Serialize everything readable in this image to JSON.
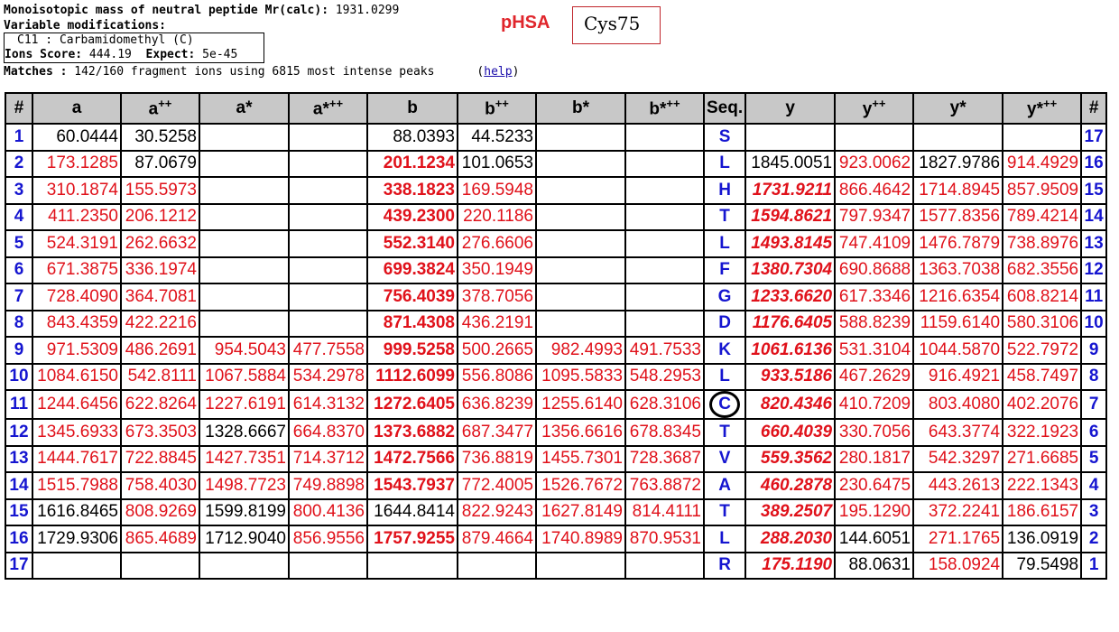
{
  "header": {
    "mass_label": "Monoisotopic mass of neutral peptide Mr(calc):",
    "mass_value": "1931.0299",
    "varmod_label": "Variable modifications:",
    "varmod_line": "C11 : Carbamidomethyl (C)",
    "score_label": "Ions Score:",
    "score_value": "444.19",
    "expect_label": "Expect:",
    "expect_value": "5e-45",
    "matches_label": "Matches :",
    "matches_value": "142/160 fragment ions using 6815 most intense peaks",
    "help_link": "help"
  },
  "protein_label": "pHSA",
  "site_label": "Cys75",
  "table": {
    "headers": [
      "#",
      "a",
      "a",
      "a*",
      "a*",
      "b",
      "b",
      "b*",
      "b*",
      "Seq.",
      "y",
      "y",
      "y*",
      "y*",
      "#"
    ],
    "header_sups": [
      "",
      "",
      "++",
      "",
      "++",
      "",
      "++",
      "",
      "++",
      "",
      "",
      "++",
      "",
      "++",
      ""
    ],
    "rows": [
      {
        "n": "1",
        "a": "60.0444",
        "a2": "30.5258",
        "as": "",
        "as2": "",
        "b": "88.0393",
        "b2": "44.5233",
        "bs": "",
        "bs2": "",
        "seq": "S",
        "y": "",
        "y2": "",
        "ys": "",
        "ys2": "",
        "m": "17"
      },
      {
        "n": "2",
        "a": "173.1285",
        "a2": "87.0679",
        "as": "",
        "as2": "",
        "b": "201.1234",
        "b2": "101.0653",
        "bs": "",
        "bs2": "",
        "seq": "L",
        "y": "1845.0051",
        "y2": "923.0062",
        "ys": "1827.9786",
        "ys2": "914.4929",
        "m": "16"
      },
      {
        "n": "3",
        "a": "310.1874",
        "a2": "155.5973",
        "as": "",
        "as2": "",
        "b": "338.1823",
        "b2": "169.5948",
        "bs": "",
        "bs2": "",
        "seq": "H",
        "y": "1731.9211",
        "y2": "866.4642",
        "ys": "1714.8945",
        "ys2": "857.9509",
        "m": "15"
      },
      {
        "n": "4",
        "a": "411.2350",
        "a2": "206.1212",
        "as": "",
        "as2": "",
        "b": "439.2300",
        "b2": "220.1186",
        "bs": "",
        "bs2": "",
        "seq": "T",
        "y": "1594.8621",
        "y2": "797.9347",
        "ys": "1577.8356",
        "ys2": "789.4214",
        "m": "14"
      },
      {
        "n": "5",
        "a": "524.3191",
        "a2": "262.6632",
        "as": "",
        "as2": "",
        "b": "552.3140",
        "b2": "276.6606",
        "bs": "",
        "bs2": "",
        "seq": "L",
        "y": "1493.8145",
        "y2": "747.4109",
        "ys": "1476.7879",
        "ys2": "738.8976",
        "m": "13"
      },
      {
        "n": "6",
        "a": "671.3875",
        "a2": "336.1974",
        "as": "",
        "as2": "",
        "b": "699.3824",
        "b2": "350.1949",
        "bs": "",
        "bs2": "",
        "seq": "F",
        "y": "1380.7304",
        "y2": "690.8688",
        "ys": "1363.7038",
        "ys2": "682.3556",
        "m": "12"
      },
      {
        "n": "7",
        "a": "728.4090",
        "a2": "364.7081",
        "as": "",
        "as2": "",
        "b": "756.4039",
        "b2": "378.7056",
        "bs": "",
        "bs2": "",
        "seq": "G",
        "y": "1233.6620",
        "y2": "617.3346",
        "ys": "1216.6354",
        "ys2": "608.8214",
        "m": "11"
      },
      {
        "n": "8",
        "a": "843.4359",
        "a2": "422.2216",
        "as": "",
        "as2": "",
        "b": "871.4308",
        "b2": "436.2191",
        "bs": "",
        "bs2": "",
        "seq": "D",
        "y": "1176.6405",
        "y2": "588.8239",
        "ys": "1159.6140",
        "ys2": "580.3106",
        "m": "10"
      },
      {
        "n": "9",
        "a": "971.5309",
        "a2": "486.2691",
        "as": "954.5043",
        "as2": "477.7558",
        "b": "999.5258",
        "b2": "500.2665",
        "bs": "982.4993",
        "bs2": "491.7533",
        "seq": "K",
        "y": "1061.6136",
        "y2": "531.3104",
        "ys": "1044.5870",
        "ys2": "522.7972",
        "m": "9"
      },
      {
        "n": "10",
        "a": "1084.6150",
        "a2": "542.8111",
        "as": "1067.5884",
        "as2": "534.2978",
        "b": "1112.6099",
        "b2": "556.8086",
        "bs": "1095.5833",
        "bs2": "548.2953",
        "seq": "L",
        "y": "933.5186",
        "y2": "467.2629",
        "ys": "916.4921",
        "ys2": "458.7497",
        "m": "8"
      },
      {
        "n": "11",
        "a": "1244.6456",
        "a2": "622.8264",
        "as": "1227.6191",
        "as2": "614.3132",
        "b": "1272.6405",
        "b2": "636.8239",
        "bs": "1255.6140",
        "bs2": "628.3106",
        "seq": "C",
        "y": "820.4346",
        "y2": "410.7209",
        "ys": "803.4080",
        "ys2": "402.2076",
        "m": "7"
      },
      {
        "n": "12",
        "a": "1345.6933",
        "a2": "673.3503",
        "as": "1328.6667",
        "as2": "664.8370",
        "b": "1373.6882",
        "b2": "687.3477",
        "bs": "1356.6616",
        "bs2": "678.8345",
        "seq": "T",
        "y": "660.4039",
        "y2": "330.7056",
        "ys": "643.3774",
        "ys2": "322.1923",
        "m": "6"
      },
      {
        "n": "13",
        "a": "1444.7617",
        "a2": "722.8845",
        "as": "1427.7351",
        "as2": "714.3712",
        "b": "1472.7566",
        "b2": "736.8819",
        "bs": "1455.7301",
        "bs2": "728.3687",
        "seq": "V",
        "y": "559.3562",
        "y2": "280.1817",
        "ys": "542.3297",
        "ys2": "271.6685",
        "m": "5"
      },
      {
        "n": "14",
        "a": "1515.7988",
        "a2": "758.4030",
        "as": "1498.7723",
        "as2": "749.8898",
        "b": "1543.7937",
        "b2": "772.4005",
        "bs": "1526.7672",
        "bs2": "763.8872",
        "seq": "A",
        "y": "460.2878",
        "y2": "230.6475",
        "ys": "443.2613",
        "ys2": "222.1343",
        "m": "4"
      },
      {
        "n": "15",
        "a": "1616.8465",
        "a2": "808.9269",
        "as": "1599.8199",
        "as2": "800.4136",
        "b": "1644.8414",
        "b2": "822.9243",
        "bs": "1627.8149",
        "bs2": "814.4111",
        "seq": "T",
        "y": "389.2507",
        "y2": "195.1290",
        "ys": "372.2241",
        "ys2": "186.6157",
        "m": "3"
      },
      {
        "n": "16",
        "a": "1729.9306",
        "a2": "865.4689",
        "as": "1712.9040",
        "as2": "856.9556",
        "b": "1757.9255",
        "b2": "879.4664",
        "bs": "1740.8989",
        "bs2": "870.9531",
        "seq": "L",
        "y": "288.2030",
        "y2": "144.6051",
        "ys": "271.1765",
        "ys2": "136.0919",
        "m": "2"
      },
      {
        "n": "17",
        "a": "",
        "a2": "",
        "as": "",
        "as2": "",
        "b": "",
        "b2": "",
        "bs": "",
        "bs2": "",
        "seq": "R",
        "y": "175.1190",
        "y2": "88.0631",
        "ys": "158.0924",
        "ys2": "79.5498",
        "m": "1"
      }
    ],
    "black_cells": [
      "1.a",
      "1.a2",
      "1.b",
      "1.b2",
      "2.a2",
      "2.b2",
      "2.y",
      "2.ys",
      "12.as",
      "15.a",
      "15.as",
      "15.b",
      "16.a",
      "16.as",
      "16.y2",
      "16.ys2",
      "17.y2",
      "17.ys2"
    ]
  }
}
